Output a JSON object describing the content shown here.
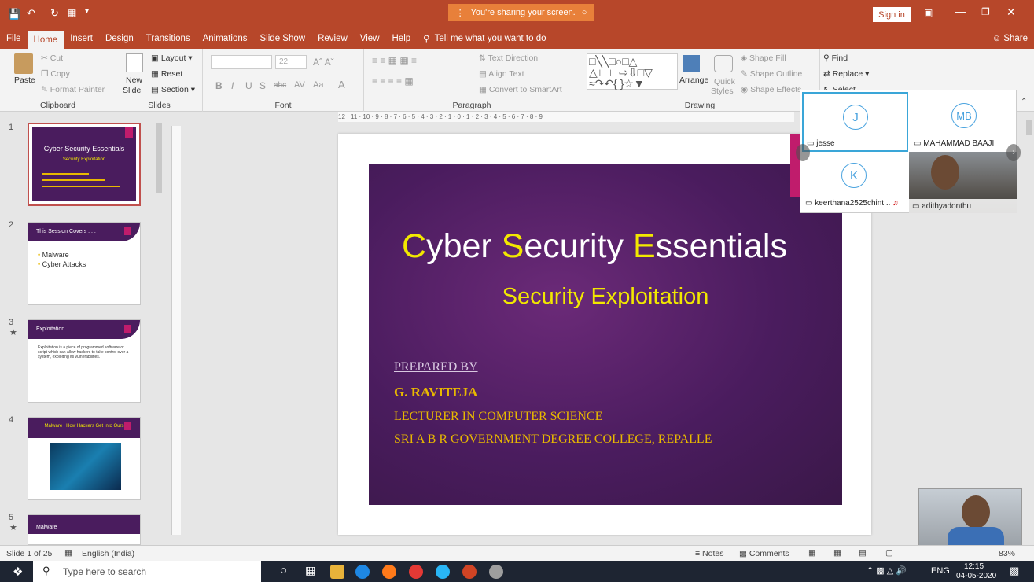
{
  "titlebar": {
    "sharing_text": "You're sharing your screen.",
    "signin": "Sign in"
  },
  "menu": {
    "tabs": [
      "File",
      "Home",
      "Insert",
      "Design",
      "Transitions",
      "Animations",
      "Slide Show",
      "Review",
      "View",
      "Help"
    ],
    "tellme": "Tell me what you want to do",
    "share": "Share"
  },
  "ribbon": {
    "clipboard": {
      "paste": "Paste",
      "cut": "Cut",
      "copy": "Copy",
      "format_painter": "Format Painter",
      "label": "Clipboard"
    },
    "slides": {
      "new_slide_1": "New",
      "new_slide_2": "Slide",
      "layout": "Layout",
      "reset": "Reset",
      "section": "Section",
      "label": "Slides"
    },
    "font": {
      "size": "22",
      "label": "Font"
    },
    "paragraph": {
      "text_direction": "Text Direction",
      "align_text": "Align Text",
      "convert": "Convert to SmartArt",
      "label": "Paragraph"
    },
    "drawing": {
      "arrange": "Arrange",
      "quick_styles_1": "Quick",
      "quick_styles_2": "Styles",
      "shape_fill": "Shape Fill",
      "shape_outline": "Shape Outline",
      "shape_effects": "Shape Effects",
      "label": "Drawing"
    },
    "editing": {
      "find": "Find",
      "replace": "Replace",
      "select": "Select"
    }
  },
  "thumbnails": [
    {
      "num": "1",
      "title": "Cyber Security Essentials",
      "subtitle": "Security Exploitation"
    },
    {
      "num": "2",
      "title": "This Session Covers . . .",
      "items": [
        "Malware",
        "Cyber Attacks"
      ]
    },
    {
      "num": "3",
      "title": "Exploitation",
      "body": "Exploitation is a piece of programmed software or script which can allow hackers to take control over a system, exploiting its vulnerabilities."
    },
    {
      "num": "4",
      "title": "Malware : How Hackers Get Into Ours"
    },
    {
      "num": "5",
      "title": "Malware"
    }
  ],
  "ruler": {
    "text": "12 · 11 · 10 · 9 · 8 · 7 · 6 · 5 · 4 · 3 · 2 · 1 · 0 · 1 · 2 · 3 · 4 · 5 · 6 · 7 · 8 · 9"
  },
  "slide": {
    "title_c": "C",
    "title_1": "yber ",
    "title_s": "S",
    "title_2": "ecurity ",
    "title_e": "E",
    "title_3": "ssentials",
    "subtitle": "Security Exploitation",
    "prepared_by": "PREPARED BY",
    "name": "G. RAVITEJA",
    "role": "LECTURER IN COMPUTER SCIENCE",
    "college": "SRI A B R GOVERNMENT DEGREE COLLEGE, REPALLE"
  },
  "meeting": {
    "participants": [
      {
        "initials": "J",
        "name": "jesse"
      },
      {
        "initials": "MB",
        "name": "MAHAMMAD BAAJI"
      },
      {
        "initials": "K",
        "name": "keerthana2525chint..."
      },
      {
        "initials": "",
        "name": "adithyadonthu"
      }
    ]
  },
  "statusbar": {
    "slide_of": "Slide 1 of 25",
    "language": "English (India)",
    "notes": "Notes",
    "comments": "Comments",
    "zoom": "83%"
  },
  "taskbar": {
    "search_placeholder": "Type here to search",
    "lang": "ENG",
    "time": "12:15",
    "date": "04-05-2020"
  },
  "colors": {
    "accent": "#b7472a",
    "slide_bg": "#4a1c5e",
    "title_yellow": "#f2e800",
    "gold": "#e8b800",
    "meet_highlight": "#3aa6d8"
  }
}
